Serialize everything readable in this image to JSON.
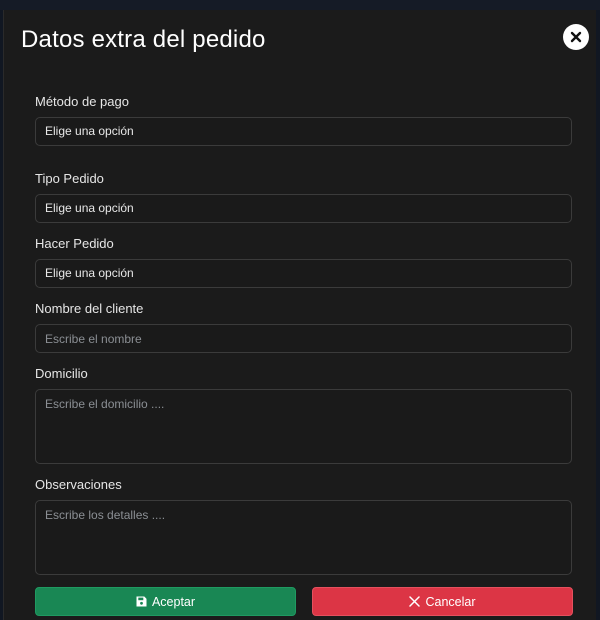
{
  "modal": {
    "title": "Datos extra del pedido"
  },
  "fields": {
    "payment_method": {
      "label": "Método de pago",
      "value": "Elige una opción"
    },
    "order_type": {
      "label": "Tipo Pedido",
      "value": "Elige una opción"
    },
    "place_order": {
      "label": "Hacer Pedido",
      "value": "Elige una opción"
    },
    "customer_name": {
      "label": "Nombre del cliente",
      "value": "",
      "placeholder": "Escribe el nombre"
    },
    "address": {
      "label": "Domicilio",
      "value": "",
      "placeholder": "Escribe el domicilio ...."
    },
    "notes": {
      "label": "Observaciones",
      "value": "",
      "placeholder": "Escribe los detalles ...."
    }
  },
  "buttons": {
    "accept_label": "Aceptar",
    "cancel_label": "Cancelar"
  },
  "icons": {
    "close": "close-icon",
    "accept": "save-icon",
    "cancel": "x-icon"
  },
  "colors": {
    "accept": "#198754",
    "cancel": "#dc3545",
    "modal_background": "#1b1b1b"
  }
}
